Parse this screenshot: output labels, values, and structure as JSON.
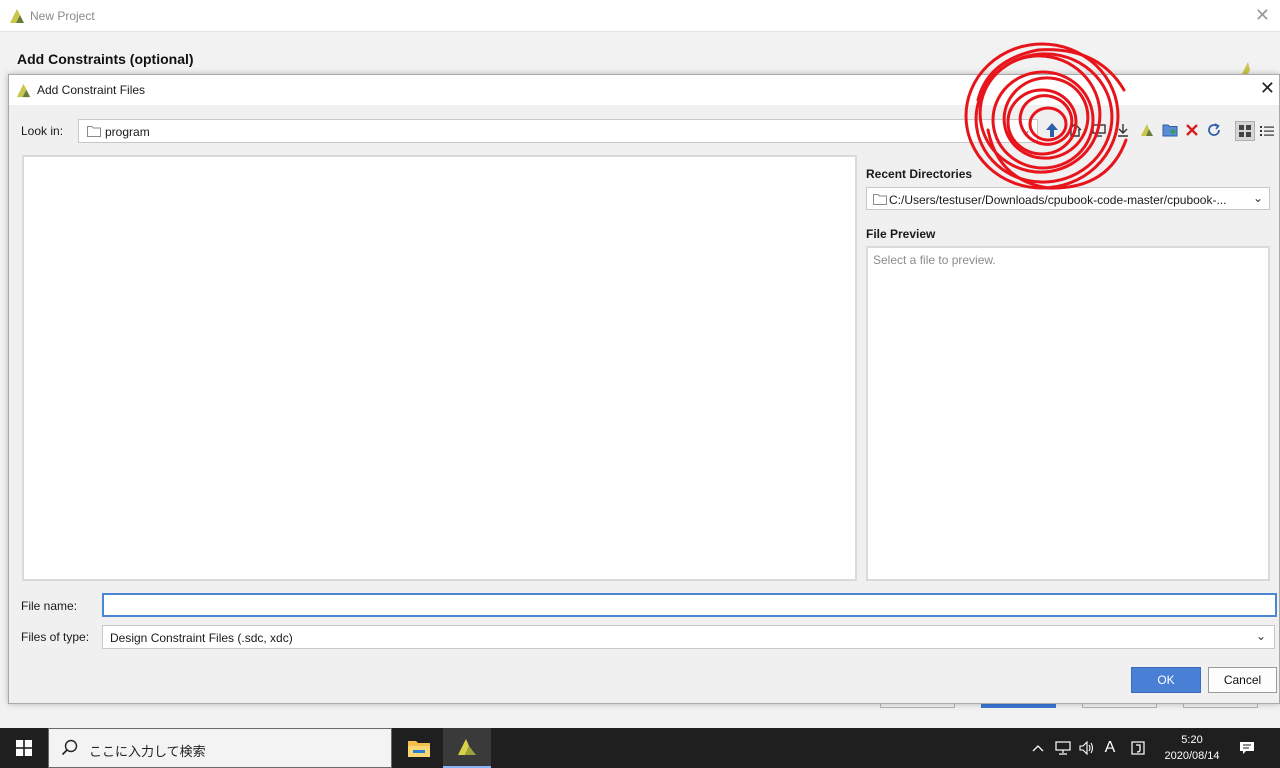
{
  "wizard": {
    "title": "New Project",
    "heading": "Add Constraints (optional)"
  },
  "dialog": {
    "title": "Add Constraint Files",
    "look_in_label": "Look in:",
    "look_in_value": "program",
    "recent_label": "Recent Directories",
    "recent_value": "C:/Users/testuser/Downloads/cpubook-code-master/cpubook-...",
    "preview_label": "File Preview",
    "preview_placeholder": "Select a file to preview.",
    "file_name_label": "File name:",
    "file_name_value": "",
    "file_type_label": "Files of type:",
    "file_type_value": "Design Constraint Files (.sdc, xdc)",
    "ok_label": "OK",
    "cancel_label": "Cancel"
  },
  "toolbar_icons": [
    "up-folder-icon",
    "home-icon",
    "desktop-icon",
    "download-icon",
    "xilinx-project-icon",
    "new-folder-icon",
    "delete-icon",
    "refresh-icon"
  ],
  "view_icons": [
    "grid-view-icon",
    "list-view-icon"
  ],
  "taskbar": {
    "search_placeholder": "ここに入力して検索",
    "ime_indicator": "A",
    "time": "5:20",
    "date": "2020/08/14"
  },
  "colors": {
    "accent": "#4a7fd6",
    "scribble": "#e8141c",
    "taskbar": "#1f1f1f"
  }
}
